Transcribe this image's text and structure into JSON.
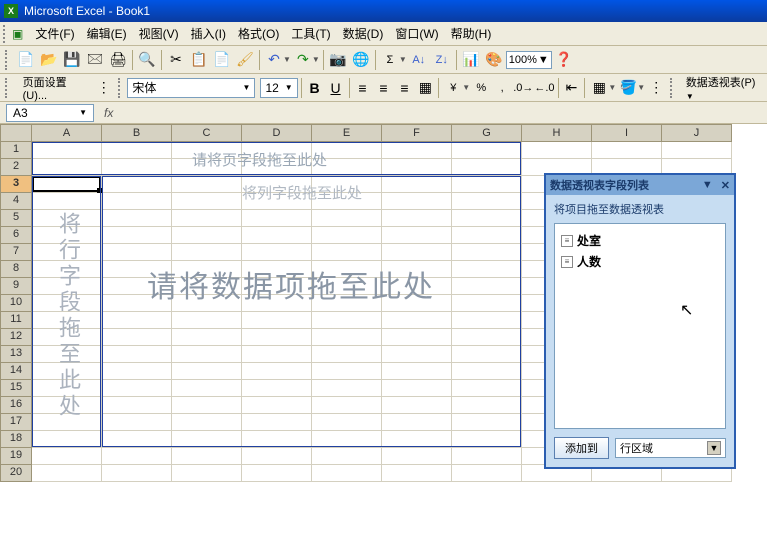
{
  "window": {
    "title": "Microsoft Excel - Book1"
  },
  "menu": {
    "file": "文件(F)",
    "edit": "编辑(E)",
    "view": "视图(V)",
    "insert": "插入(I)",
    "format": "格式(O)",
    "tools": "工具(T)",
    "data": "数据(D)",
    "window": "窗口(W)",
    "help": "帮助(H)"
  },
  "toolbar1": {
    "zoom": "100%"
  },
  "toolbar2": {
    "page_setup": "页面设置(U)...",
    "font_name": "宋体",
    "font_size": "12",
    "pivot_label": "数据透视表(P)"
  },
  "namebox": {
    "value": "A3",
    "fx": "fx"
  },
  "columns": [
    "A",
    "B",
    "C",
    "D",
    "E",
    "F",
    "G",
    "H",
    "I",
    "J"
  ],
  "rows": [
    "1",
    "2",
    "3",
    "4",
    "5",
    "6",
    "7",
    "8",
    "9",
    "10",
    "11",
    "12",
    "13",
    "14",
    "15",
    "16",
    "17",
    "18",
    "19",
    "20"
  ],
  "selected_row": "3",
  "pivot_drop": {
    "page": "请将页字段拖至此处",
    "col": "将列字段拖至此处",
    "row": "将行字段拖至此处",
    "data": "请将数据项拖至此处"
  },
  "fieldlist": {
    "title": "数据透视表字段列表",
    "caption": "将项目拖至数据透视表",
    "items": [
      "处室",
      "人数"
    ],
    "add_btn": "添加到",
    "area_select": "行区域"
  }
}
